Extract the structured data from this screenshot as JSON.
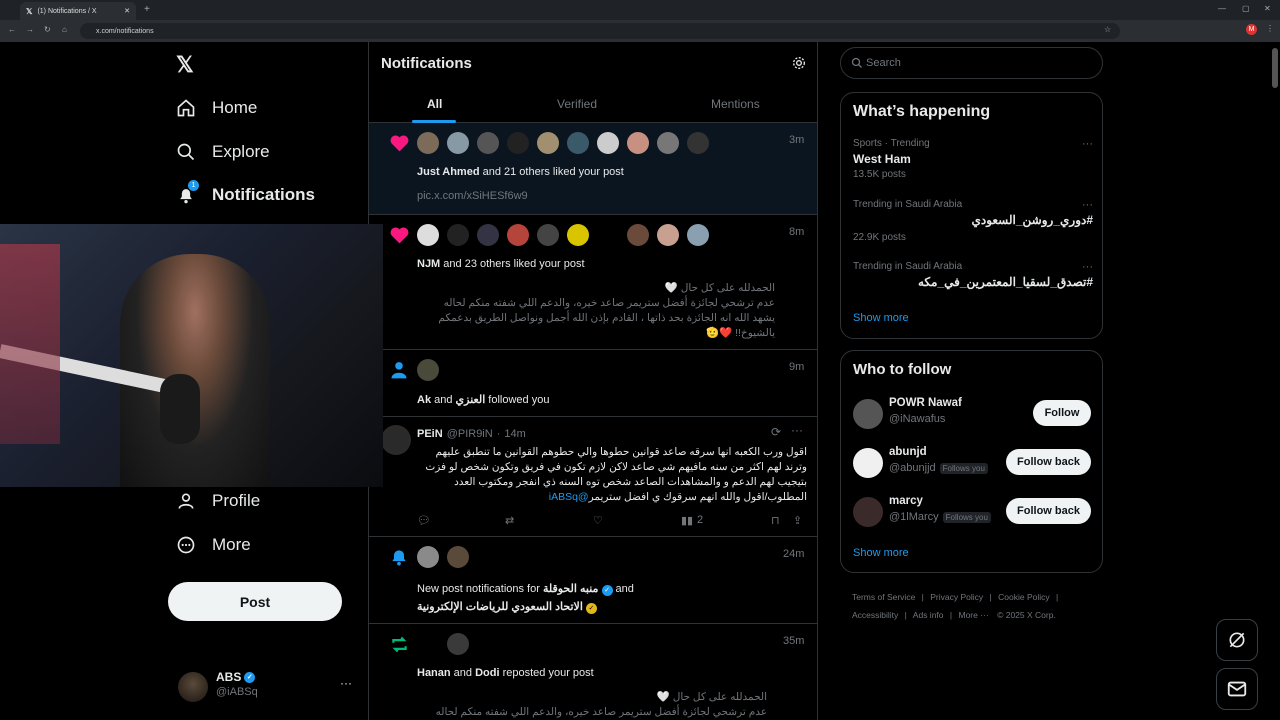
{
  "browser": {
    "tab_title": "(1) Notifications / X",
    "url": "x.com/notifications",
    "new_tab": "+"
  },
  "sidebar": {
    "items": [
      {
        "label": "Home",
        "icon": "home-icon"
      },
      {
        "label": "Explore",
        "icon": "search-icon"
      },
      {
        "label": "Notifications",
        "icon": "bell-icon",
        "badge": "1"
      },
      {
        "label": "Profile",
        "icon": "person-icon"
      },
      {
        "label": "More",
        "icon": "more-circle-icon"
      }
    ],
    "post_label": "Post",
    "account": {
      "name": "ABS",
      "handle": "@iABSq",
      "more": "···"
    }
  },
  "feed": {
    "title": "Notifications",
    "tabs": [
      "All",
      "Verified",
      "Mentions"
    ],
    "notifications": [
      {
        "time": "3m",
        "actor": "Just Ahmed",
        "text": " and 21 others liked your post",
        "link": "pic.x.com/xSiHESf6w9"
      },
      {
        "time": "8m",
        "actor": "NJM",
        "text": " and 23 others liked your post",
        "quote": [
          "الحمدلله على كل حال 🤍",
          "عدم ترشحي لجائزة أفضل ستريمر صاعد خيره، والدعم اللي شفته منكم لحاله",
          "يشهد الله انه الجائزة بحد ذاتها ، القادم بإذن الله أجمل ونواصل الطريق بدعمكم",
          "يالشيوخ!! ❤️🫡"
        ]
      },
      {
        "time": "9m",
        "actor": "Ak",
        "and": " and ",
        "actor2": "العنزي",
        "text": " followed you"
      },
      {
        "time": "14m",
        "name": "PEiN",
        "handle": "@PIR9iN",
        "dot": "·",
        "body": [
          "اقول ورب الكعبه انها سرقه  صاعد قوانين حطوها والي حطوهم القوانين ما تنطبق عليهم",
          "وترند لهم اكثر من سنه مافيهم شي صاعد لاكن لازم تكون في فريق وتكون شخص لو فزت",
          "بتيجيب لهم الدعم و والمشاهدات الصاعد شخص توه السنه ذي انفجر ومكتوب العدد",
          "المطلوب/اقول والله انهم سرقوك ي افضل ستريمر"
        ],
        "mention": "@iABSq",
        "views": "2"
      },
      {
        "time": "24m",
        "text_a": "New post notifications for ",
        "actor": "منبه الحوقلة",
        "and": " and",
        "actor2": "الاتحاد السعودي للرياضات الإلكترونية"
      },
      {
        "time": "35m",
        "actor": "Hanan",
        "and": " and ",
        "actor2": "Dodi",
        "text": " reposted your post",
        "quote": [
          "الحمدلله على كل حال 🤍",
          "عدم ترشحي لجائزة أفضل ستريمر صاعد خيره، والدعم اللي شفته منكم لحاله"
        ]
      }
    ]
  },
  "right": {
    "search_placeholder": "Search",
    "happening_title": "What’s happening",
    "trends": [
      {
        "meta": "Sports · Trending",
        "name": "West Ham",
        "posts": "13.5K posts"
      },
      {
        "meta": "Trending in Saudi Arabia",
        "name": "#دوري_روشن_السعودي",
        "posts": "22.9K posts"
      },
      {
        "meta": "Trending in Saudi Arabia",
        "name": "#تصدق_لسقيا_المعتمرين_في_مكه",
        "posts": ""
      }
    ],
    "show_more": "Show more",
    "follow_title": "Who to follow",
    "follow": [
      {
        "name": "POWR Nawaf",
        "handle": "@iNawafus",
        "button": "Follow",
        "follows_you": ""
      },
      {
        "name": "abunjd",
        "handle": "@abunjjd",
        "button": "Follow back",
        "follows_you": "Follows you"
      },
      {
        "name": "marcy",
        "handle": "@1lMarcy",
        "button": "Follow back",
        "follows_you": "Follows you"
      }
    ],
    "footer": [
      "Terms of Service",
      "|",
      "Privacy Policy",
      "|",
      "Cookie Policy",
      "|",
      "Accessibility",
      "|",
      "Ads info",
      "|",
      "More ···",
      "© 2025 X Corp."
    ]
  },
  "colors": {
    "accent": "#1d9bf0",
    "like": "#f91880",
    "repost": "#00ba7c",
    "bg": "#000000",
    "border": "#2f3336"
  }
}
